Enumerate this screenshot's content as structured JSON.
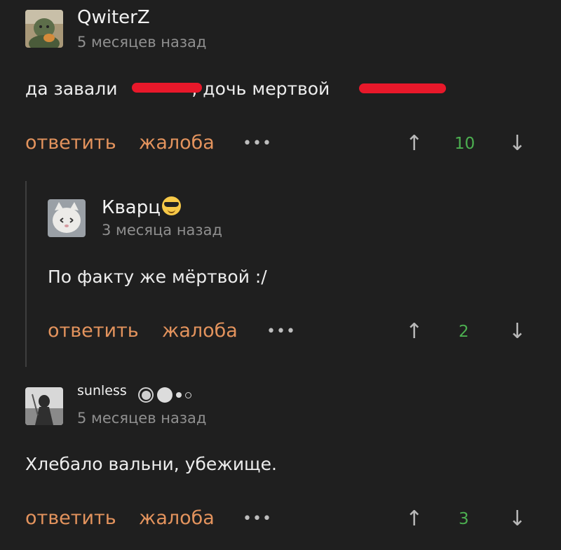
{
  "comments": [
    {
      "username": "QwiterZ",
      "time": "5 месяцев назад",
      "text_parts": [
        "да завали ",
        ", дочь мертвой "
      ],
      "reply_label": "ответить",
      "report_label": "жалоба",
      "more_label": "•••",
      "score": "10",
      "upvote_icon": "↑",
      "downvote_icon": "↓"
    },
    {
      "username": "Кварц",
      "time": "3 месяца назад",
      "text": "По факту же мёртвой :/",
      "reply_label": "ответить",
      "report_label": "жалоба",
      "more_label": "•••",
      "score": "2",
      "upvote_icon": "↑",
      "downvote_icon": "↓"
    },
    {
      "username": "sunless",
      "time": "5 месяцев назад",
      "text": "Хлебало вальни, убежище.",
      "reply_label": "ответить",
      "report_label": "жалоба",
      "more_label": "•••",
      "score": "3",
      "upvote_icon": "↑",
      "downvote_icon": "↓"
    }
  ],
  "colors": {
    "background": "#1f1f1f",
    "action": "#e3935d",
    "score": "#4caf50",
    "redaction": "#e8182a"
  }
}
